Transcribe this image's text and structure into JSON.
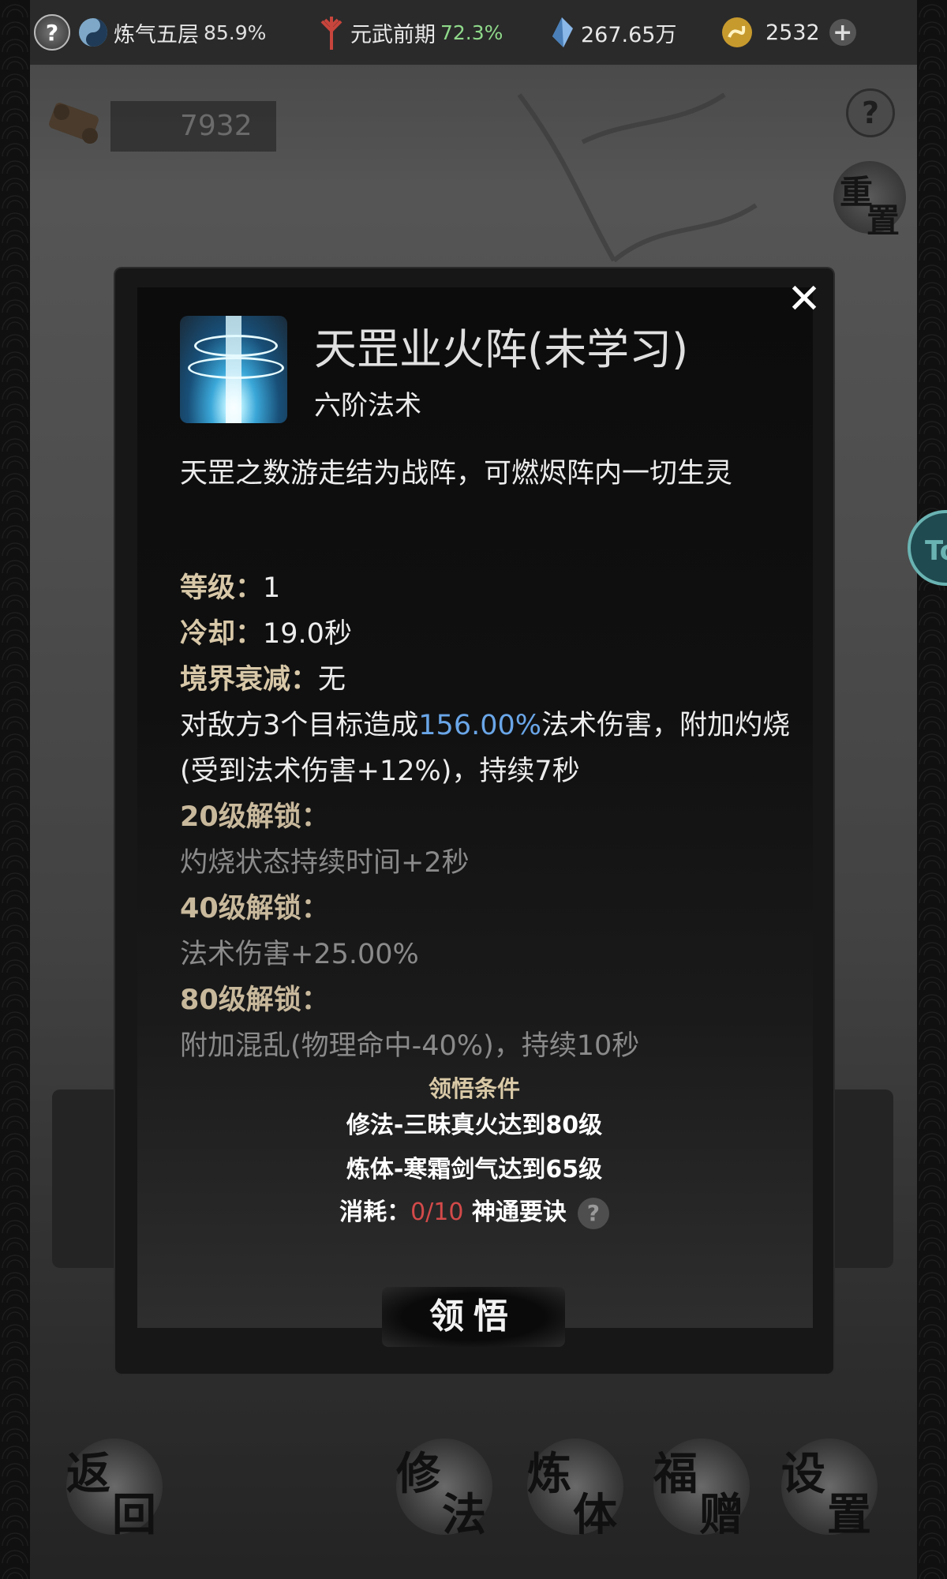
{
  "topbar": {
    "help": "?",
    "realm_label": "炼气五层",
    "realm_pct": "85.9%",
    "martial_label": "元武前期",
    "martial_pct": "72.3%",
    "spirit_stones": "267.65万",
    "currency": "2532",
    "add": "+"
  },
  "scroll_count": "7932",
  "help_label": "?",
  "reset_chars": [
    "重",
    "置"
  ],
  "side_tab": "To",
  "modal": {
    "close": "✕",
    "title": "天罡业火阵(未学习)",
    "type": "六阶法术",
    "description": "天罡之数游走结为战阵，可燃烬阵内一切生灵",
    "level_label": "等级：",
    "level_value": "1",
    "cooldown_label": "冷却：",
    "cooldown_value": "19.0秒",
    "decay_label": "境界衰减：",
    "decay_value": "无",
    "effect_pre": "对敌方3个目标造成",
    "effect_pct": "156.00%",
    "effect_post": "法术伤害，附加灼烧(受到法术伤害+12%)，持续7秒",
    "unlock20_label": "20级解锁：",
    "unlock20_text": "灼烧状态持续时间+2秒",
    "unlock40_label": "40级解锁：",
    "unlock40_text": "法术伤害+25.00%",
    "unlock80_label": "80级解锁：",
    "unlock80_text": "附加混乱(物理命中-40%)，持续10秒",
    "cond_title": "领悟条件",
    "cond1": "修法-三昧真火达到80级",
    "cond2": "炼体-寒霜剑气达到65级",
    "cost_label": "消耗：",
    "cost_value": "0/10",
    "cost_item": "神通要诀",
    "cost_help": "?",
    "learn_button": "领悟"
  },
  "nav": {
    "back": [
      "返",
      "回"
    ],
    "cultivate": [
      "修",
      "法"
    ],
    "body": [
      "炼",
      "体"
    ],
    "gift": [
      "福",
      "赠"
    ],
    "settings": [
      "设",
      "置"
    ]
  },
  "colors": {
    "accent_blue": "#6aa6e8",
    "cost_red": "#d34a4a",
    "gold": "#d8c8a8",
    "green": "#8fd98a"
  }
}
